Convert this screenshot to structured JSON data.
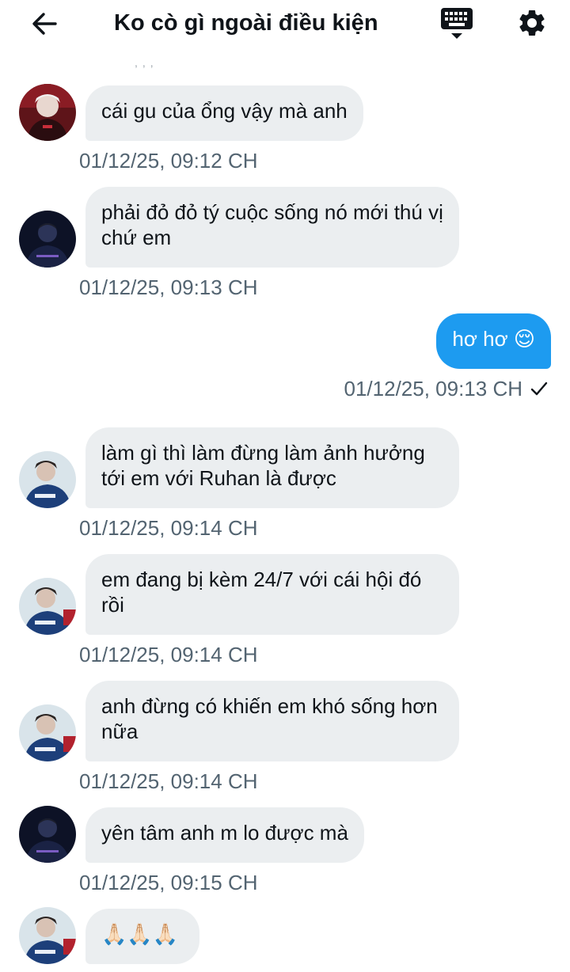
{
  "header": {
    "title": "Ko cò gì ngoài điều kiện",
    "back_icon": "arrow-left-icon",
    "keyboard_icon": "keyboard-icon",
    "settings_icon": "gear-icon"
  },
  "colors": {
    "outgoing_bubble": "#1d9bf0",
    "incoming_bubble": "#ebeef0",
    "timestamp": "#536471"
  },
  "messages": [
    {
      "direction": "in",
      "text": "cái gu của ổng vậy mà anh",
      "time": "01/12/25, 09:12 CH"
    },
    {
      "direction": "in",
      "text": "phải đỏ đỏ tý cuộc sống nó mới thú vị chứ em",
      "time": "01/12/25, 09:13 CH"
    },
    {
      "direction": "out",
      "text": "hơ hơ 😌",
      "time": "01/12/25, 09:13 CH",
      "status_icon": "checkmark-icon"
    },
    {
      "direction": "in",
      "text": "làm gì thì làm đừng làm ảnh hưởng tới em với Ruhan là được",
      "time": "01/12/25, 09:14 CH"
    },
    {
      "direction": "in",
      "text": "em đang bị kèm 24/7 với cái hội đó rồi",
      "time": "01/12/25, 09:14 CH"
    },
    {
      "direction": "in",
      "text": "anh đừng có khiến em khó sống hơn nữa",
      "time": "01/12/25, 09:14 CH"
    },
    {
      "direction": "in",
      "text": "yên tâm anh m lo được mà",
      "time": "01/12/25, 09:15 CH"
    },
    {
      "direction": "in",
      "text": "🙏🏻🙏🏻🙏🏻",
      "time": ""
    }
  ]
}
